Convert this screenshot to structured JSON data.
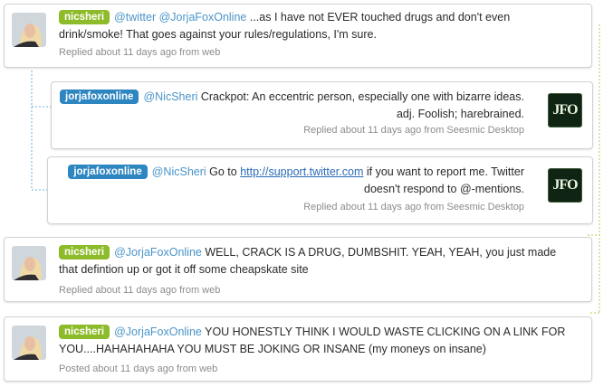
{
  "tweets": [
    {
      "username": "nicsheri",
      "mention": "@twitter @JorjaFoxOnline",
      "text": " ...as I have not EVER touched drugs and don't even drink/smoke! That goes against your rules/regulations, I'm sure.",
      "meta": "Replied about 11 days ago from web"
    },
    {
      "username": "jorjafoxonline",
      "mention": "@NicSheri",
      "text": " Crackpot: An eccentric person, especially one with bizarre ideas. adj. Foolish; harebrained.",
      "meta": "Replied about 11 days ago from Seesmic Desktop",
      "avatar_text": "JFO"
    },
    {
      "username": "jorjafoxonline",
      "mention": "@NicSheri",
      "pre_link": " Go to ",
      "link": "http://support.twitter.com",
      "post_link": " if you want to report me. Twitter doesn't respond to @-mentions.",
      "meta": "Replied about 11 days ago from Seesmic Desktop",
      "avatar_text": "JFO"
    },
    {
      "username": "nicsheri",
      "mention": "@JorjaFoxOnline",
      "text": " WELL, CRACK IS A DRUG, DUMBSHIT. YEAH, YEAH, you just made that defintion up or got it off some cheapskate site",
      "meta": "Replied about 11 days ago from web"
    },
    {
      "username": "nicsheri",
      "mention": "@JorjaFoxOnline",
      "text": " YOU HONESTLY THINK I WOULD WASTE CLICKING ON A LINK FOR YOU....HAHAHAHAHA YOU MUST BE JOKING OR INSANE (my moneys on insane)",
      "meta": "Posted about 11 days ago from web"
    }
  ],
  "colors": {
    "green_badge": "#8ebb2a",
    "blue_badge": "#2e86c1",
    "mention": "#4a94c8",
    "link": "#2a6bb5",
    "meta_text": "#8c8c8c",
    "blue_connector": "#6ab0dd",
    "green_connector": "#a9cf4a"
  },
  "icons": {
    "connector_blue": "dotted-connector-blue",
    "connector_green": "dotted-connector-green"
  }
}
